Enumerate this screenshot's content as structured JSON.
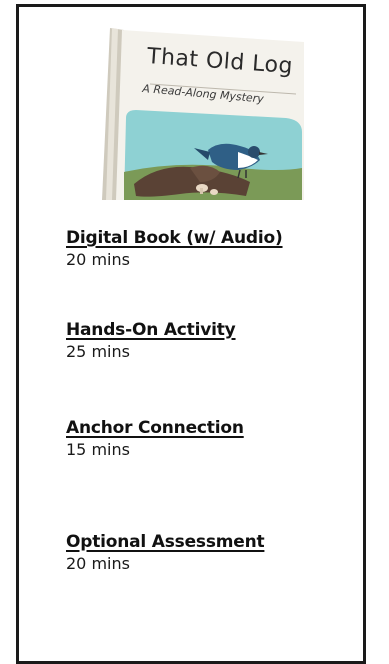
{
  "book": {
    "title": "That Old Log",
    "subtitle": "A Read-Along Mystery"
  },
  "items": [
    {
      "title": "Digital Book (w/ Audio)",
      "duration": "20 mins"
    },
    {
      "title": "Hands-On Activity",
      "duration": "25 mins"
    },
    {
      "title": "Anchor Connection",
      "duration": "15 mins"
    },
    {
      "title": "Optional Assessment",
      "duration": "20 mins"
    }
  ]
}
